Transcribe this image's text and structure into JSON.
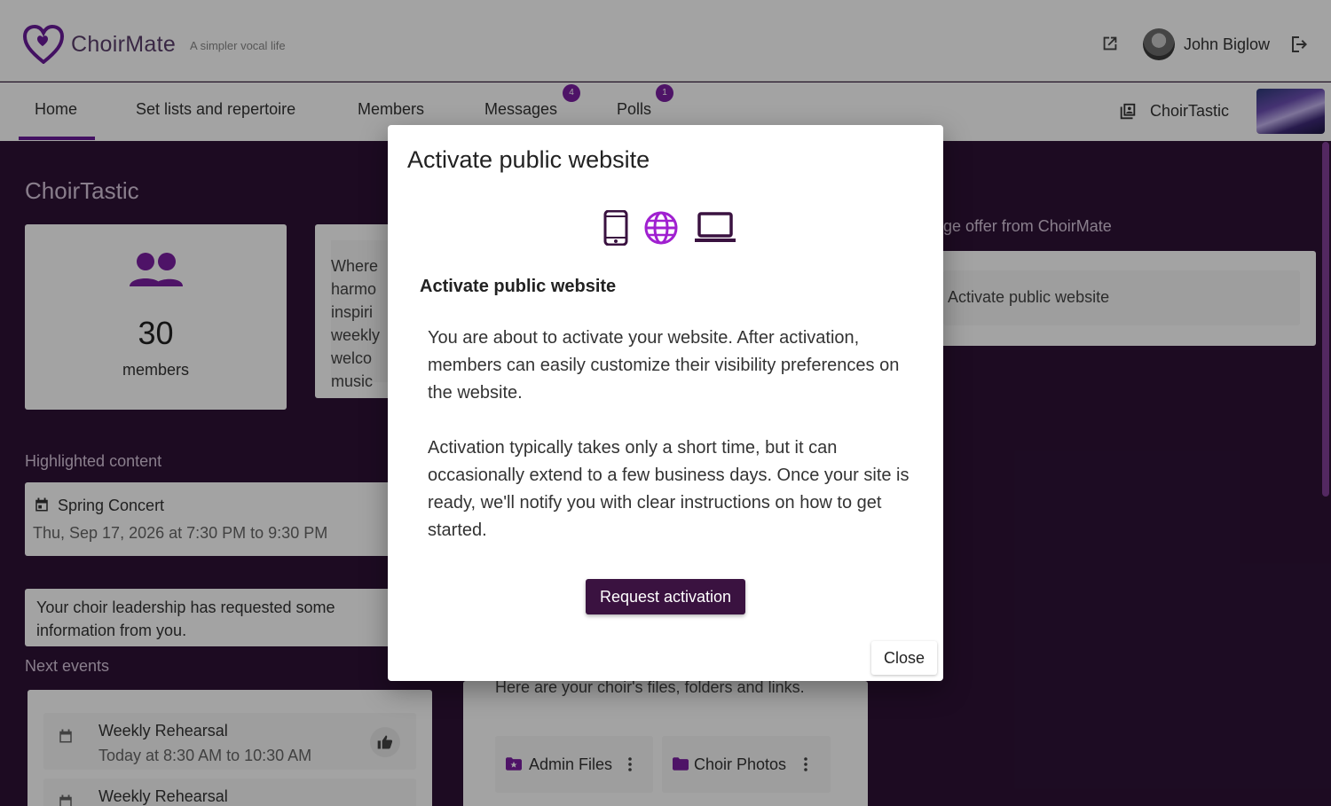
{
  "header": {
    "brand": "ChoirMate",
    "tagline": "A simpler vocal life",
    "username": "John Biglow"
  },
  "nav": {
    "tabs": [
      {
        "label": "Home",
        "active": true
      },
      {
        "label": "Set lists and repertoire"
      },
      {
        "label": "Members"
      },
      {
        "label": "Messages",
        "badge": "4"
      },
      {
        "label": "Polls",
        "badge": "1"
      }
    ],
    "choir_name": "ChoirTastic"
  },
  "dashboard": {
    "title": "ChoirTastic",
    "members_count": "30",
    "members_label": "members",
    "about_lines": [
      "Where",
      "harmo",
      "inspiri",
      "weekly",
      "welco",
      "music"
    ],
    "highlighted_label": "Highlighted content",
    "highlighted_event": {
      "title": "Spring Concert",
      "time": "Thu, Sep 17, 2026 at 7:30 PM to 9:30 PM"
    },
    "info_request": "Your choir leadership has requested some information from you.",
    "next_events_label": "Next events",
    "events": [
      {
        "title": "Weekly Rehearsal",
        "time": "Today at 8:30 AM to 10:30 AM"
      },
      {
        "title": "Weekly Rehearsal",
        "time": ""
      }
    ],
    "offer_label": "ge offer from ChoirMate",
    "offer_item": "Activate public website",
    "files_text": "Here are your choir's files, folders and links.",
    "files": [
      {
        "label": "Admin Files",
        "icon": "star-folder-icon"
      },
      {
        "label": "Choir Photos",
        "icon": "folder-icon"
      }
    ]
  },
  "modal": {
    "title": "Activate public website",
    "subheading": "Activate public website",
    "paragraph1": "You are about to activate your website. After activation, members can easily customize their visibility preferences on the website.",
    "paragraph2": "Activation typically takes only a short time, but it can occasionally extend to a few business days. Once your site is ready, we'll notify you with clear instructions on how to get started.",
    "primary_button": "Request activation",
    "close_button": "Close",
    "icons": [
      "phone-icon",
      "globe-icon",
      "laptop-icon"
    ]
  },
  "colors": {
    "accent": "#7b1fa2",
    "page_bg": "#2e1236",
    "primary_button": "#3a1240"
  }
}
